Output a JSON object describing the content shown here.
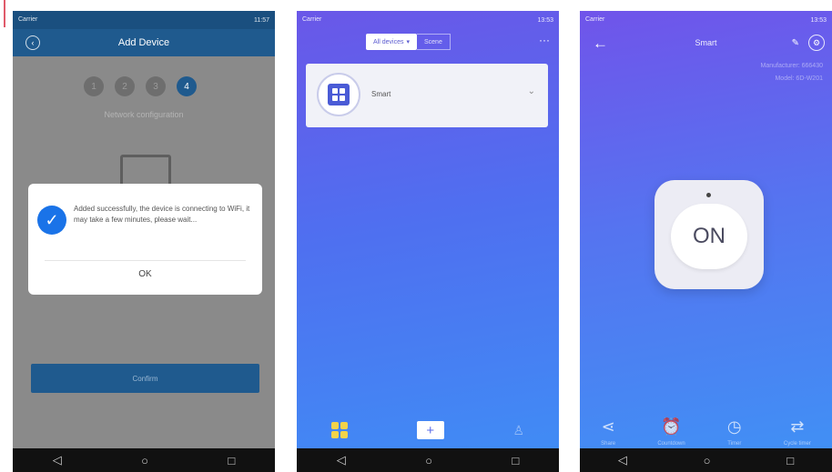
{
  "phone1": {
    "status_left": "Carrier",
    "status_right": "11:57",
    "header_title": "Add Device",
    "steps": [
      "1",
      "2",
      "3",
      "4"
    ],
    "active_step": 4,
    "step_label": "Network configuration",
    "dialog": {
      "message": "Added successfully, the device is connecting to WiFi, it may take a few minutes, please wait...",
      "ok_label": "OK"
    },
    "confirm_label": "Confirm"
  },
  "phone2": {
    "status_left": "Carrier",
    "status_right": "13:53",
    "tabs": [
      {
        "label": "All devices"
      },
      {
        "label": "Scene"
      }
    ],
    "device": {
      "name": "Smart"
    }
  },
  "phone3": {
    "status_left": "Carrier",
    "status_right": "13:53",
    "title": "Smart",
    "info_lines": [
      "Manufacturer: 666430",
      "Model: 6D-W201"
    ],
    "button_label": "ON",
    "actions": [
      {
        "icon": "share-icon",
        "label": "Share"
      },
      {
        "icon": "alarm-icon",
        "label": "Countdown"
      },
      {
        "icon": "timer-icon",
        "label": "Timer"
      },
      {
        "icon": "cycle-icon",
        "label": "Cycle timer"
      }
    ]
  },
  "colors": {
    "accent_blue": "#1f5a8e",
    "purple_gradient_top": "#6a57e8",
    "blue_gradient_bottom": "#3f8ef5",
    "check_blue": "#1a73e8"
  }
}
